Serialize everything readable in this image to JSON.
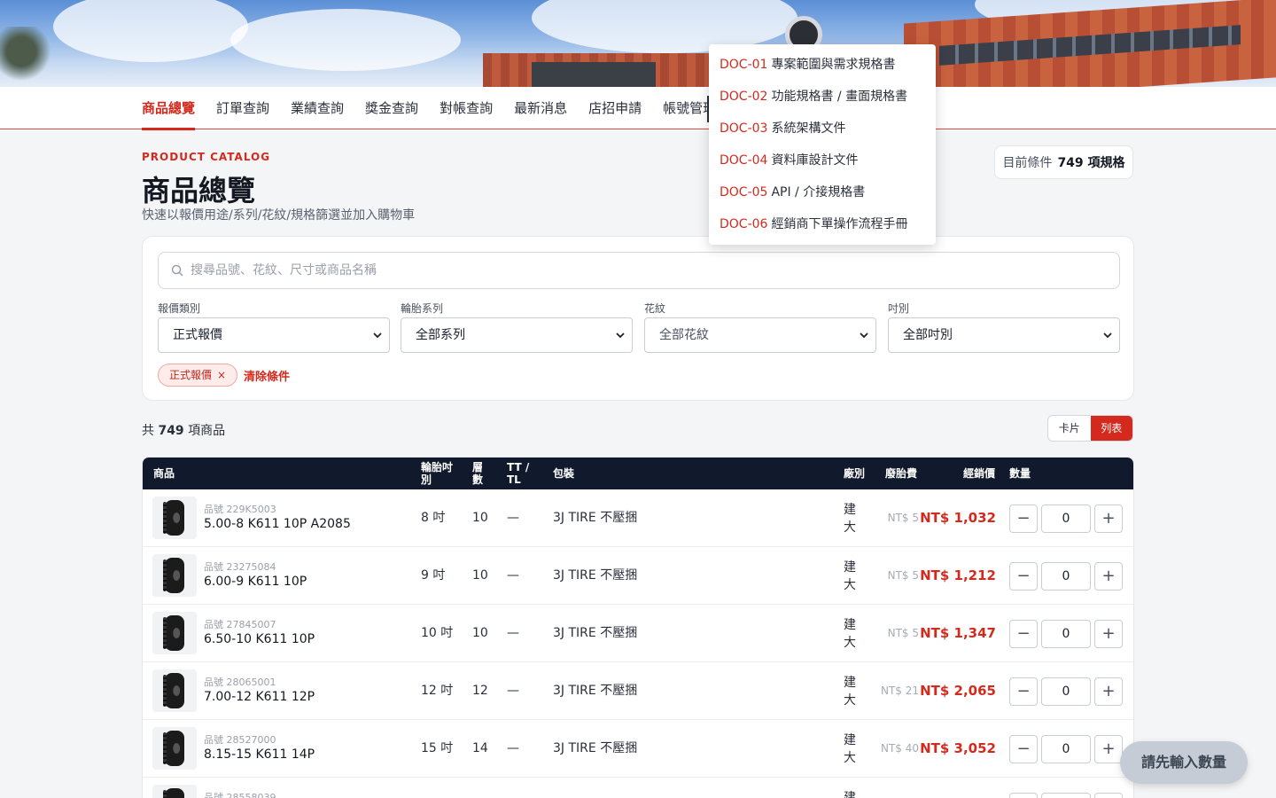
{
  "nav": {
    "items": [
      {
        "label": "商品總覽",
        "active": true
      },
      {
        "label": "訂單查詢"
      },
      {
        "label": "業績查詢"
      },
      {
        "label": "獎金查詢"
      },
      {
        "label": "對帳查詢"
      },
      {
        "label": "最新消息"
      },
      {
        "label": "店招申請"
      },
      {
        "label": "帳號管理"
      }
    ]
  },
  "doc_menu": [
    {
      "code": "DOC-01",
      "label": "專案範圍與需求規格書"
    },
    {
      "code": "DOC-02",
      "label": "功能規格書 / 畫面規格書"
    },
    {
      "code": "DOC-03",
      "label": "系統架構文件"
    },
    {
      "code": "DOC-04",
      "label": "資料庫設計文件"
    },
    {
      "code": "DOC-05",
      "label": "API / 介接規格書"
    },
    {
      "code": "DOC-06",
      "label": "經銷商下單操作流程手冊"
    }
  ],
  "header": {
    "eyebrow": "PRODUCT CATALOG",
    "title": "商品總覽",
    "subtitle": "快速以報價用途/系列/花紋/規格篩選並加入購物車",
    "condition_label": "目前條件",
    "condition_value": "749 項規格"
  },
  "filters": {
    "search_placeholder": "搜尋品號、花紋、尺寸或商品名稱",
    "quote_type": {
      "label": "報價類別",
      "value": "正式報價"
    },
    "series": {
      "label": "輪胎系列",
      "value": "全部系列"
    },
    "pattern": {
      "label": "花紋",
      "value": "全部花紋"
    },
    "size": {
      "label": "吋別",
      "value": "全部吋別"
    },
    "chip": "正式報價",
    "chip_close": "×",
    "clear": "清除條件"
  },
  "results": {
    "prefix": "共",
    "count": "749",
    "suffix": "項商品",
    "view_card": "卡片",
    "view_list": "列表"
  },
  "table": {
    "headers": {
      "product": "商品",
      "inch": "輪胎吋別",
      "ply": "層數",
      "tt": "TT / TL",
      "package": "包裝",
      "factory": "廠別",
      "fee": "廢胎費",
      "price": "經銷價",
      "qty": "數量"
    },
    "rows": [
      {
        "pn": "品號 229K5003",
        "name": "5.00-8 K611 10P A2085",
        "inch": "8 吋",
        "ply": "10",
        "tt": "—",
        "package": "3J TIRE 不壓捆",
        "factory": "建大",
        "fee": "NT$ 5",
        "price": "NT$ 1,032",
        "qty": "0"
      },
      {
        "pn": "品號 23275084",
        "name": "6.00-9 K611 10P",
        "inch": "9 吋",
        "ply": "10",
        "tt": "—",
        "package": "3J TIRE 不壓捆",
        "factory": "建大",
        "fee": "NT$ 5",
        "price": "NT$ 1,212",
        "qty": "0"
      },
      {
        "pn": "品號 27845007",
        "name": "6.50-10 K611 10P",
        "inch": "10 吋",
        "ply": "10",
        "tt": "—",
        "package": "3J TIRE 不壓捆",
        "factory": "建大",
        "fee": "NT$ 5",
        "price": "NT$ 1,347",
        "qty": "0"
      },
      {
        "pn": "品號 28065001",
        "name": "7.00-12 K611 12P",
        "inch": "12 吋",
        "ply": "12",
        "tt": "—",
        "package": "3J TIRE 不壓捆",
        "factory": "建大",
        "fee": "NT$ 21",
        "price": "NT$ 2,065",
        "qty": "0"
      },
      {
        "pn": "品號 28527000",
        "name": "8.15-15 K611 14P",
        "inch": "15 吋",
        "ply": "14",
        "tt": "—",
        "package": "3J TIRE 不壓捆",
        "factory": "建大",
        "fee": "NT$ 40",
        "price": "NT$ 3,052",
        "qty": "0"
      },
      {
        "pn": "品號 28558039",
        "name": "",
        "inch": "",
        "ply": "",
        "tt": "",
        "package": "",
        "factory": "建",
        "fee": "",
        "price": "",
        "qty": ""
      }
    ],
    "minus": "−",
    "plus": "+"
  },
  "cta": "請先輸入數量",
  "colors": {
    "accent": "#d42a1e",
    "header_bg": "#111a2c"
  }
}
